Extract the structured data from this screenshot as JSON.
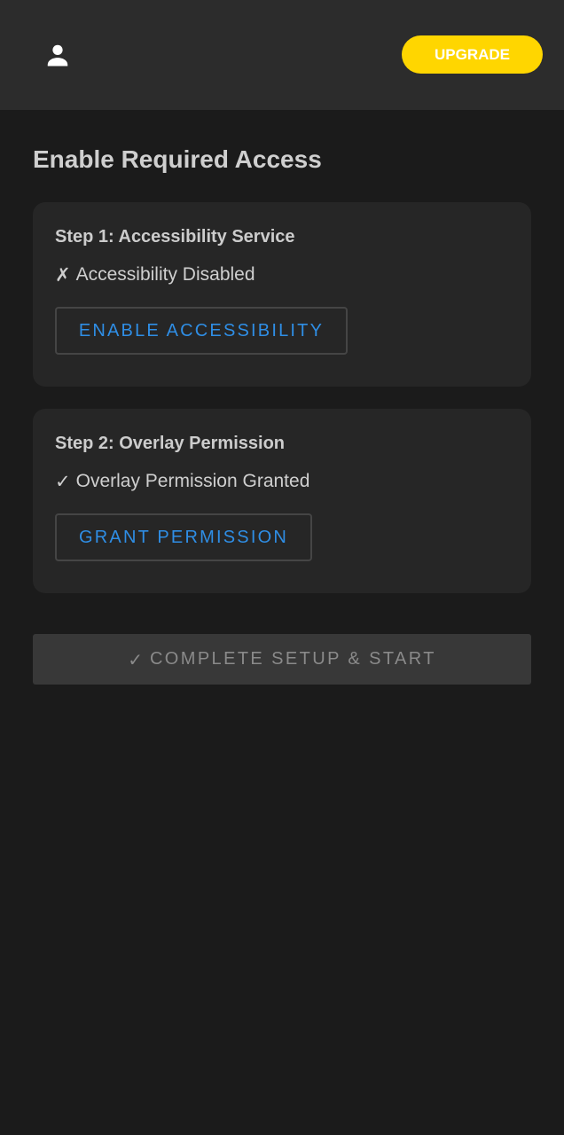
{
  "header": {
    "profile_icon": "person-icon",
    "upgrade_label": "UPGRADE",
    "upgrade_color": "#ffd600"
  },
  "page": {
    "title": "Enable Required Access"
  },
  "steps": [
    {
      "title": "Step 1: Accessibility Service",
      "status_icon": "✗",
      "status_text": "Accessibility Disabled",
      "button_label": "ENABLE ACCESSIBILITY"
    },
    {
      "title": "Step 2: Overlay Permission",
      "status_icon": "✓",
      "status_text": "Overlay Permission Granted",
      "button_label": "GRANT PERMISSION"
    }
  ],
  "complete": {
    "icon": "✓",
    "label": "COMPLETE SETUP & START"
  },
  "colors": {
    "background": "#1b1b1b",
    "topbar": "#2c2c2c",
    "card": "#262626",
    "accent_blue": "#2f8ee5"
  }
}
